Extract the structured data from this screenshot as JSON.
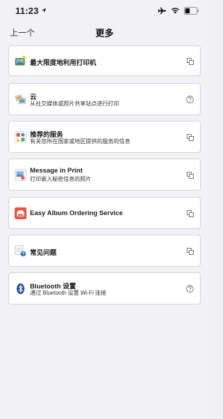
{
  "status_bar": {
    "time": "11:23",
    "location_icon": "location-arrow-icon",
    "airplane_icon": "airplane-icon",
    "wifi_icon": "wifi-icon",
    "battery_icon": "battery-icon"
  },
  "nav": {
    "back_label": "上一个",
    "title": "更多"
  },
  "items": [
    {
      "title": "最大限度地利用打印机",
      "subtitle": "",
      "icon": "printer-photo-icon",
      "trailing": "open-external-icon"
    },
    {
      "title": "云",
      "subtitle": "从社交媒体或照片共享站点进行打印",
      "icon": "cloud-photos-icon",
      "trailing": "help-icon"
    },
    {
      "title": "推荐的服务",
      "subtitle": "有关您所在国家或地区提供的服务的信息",
      "icon": "services-grid-icon",
      "trailing": "open-external-icon"
    },
    {
      "title": "Message in Print",
      "subtitle": "打印嵌入秘密信息的照片",
      "icon": "message-print-icon",
      "trailing": "open-external-icon"
    },
    {
      "title": "Easy Album Ordering Service",
      "subtitle": "",
      "icon": "album-icon",
      "trailing": "open-external-icon"
    },
    {
      "title": "常见问题",
      "subtitle": "",
      "icon": "faq-icon",
      "trailing": "open-external-icon"
    },
    {
      "title": "Bluetooth 设置",
      "subtitle": "通过 Bluetooth 设置 Wi-Fi 连接",
      "icon": "bluetooth-icon",
      "trailing": "help-icon"
    }
  ],
  "colors": {
    "background": "#f1f1f6",
    "card": "#ffffff",
    "card_border": "#d3d3d8",
    "album_icon": "#e8563f",
    "bluetooth": "#1f4fa3"
  }
}
